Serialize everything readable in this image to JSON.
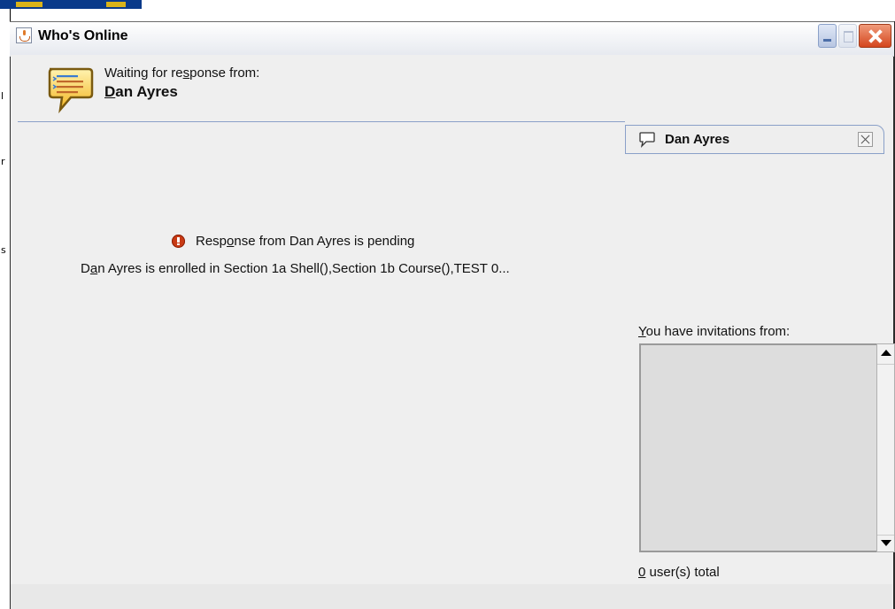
{
  "window": {
    "title": "Who's Online"
  },
  "header": {
    "waiting_prefix": "Waiting for re",
    "waiting_mnemonic": "s",
    "waiting_suffix": "ponse from:",
    "user_mnemonic": "D",
    "user_rest": "an Ayres"
  },
  "main": {
    "status_prefix": "Resp",
    "status_mnemonic": "o",
    "status_suffix": "nse from Dan Ayres is pending",
    "enrolled_prefix": "D",
    "enrolled_mnemonic": "a",
    "enrolled_suffix": "n Ayres is enrolled in Section 1a Shell(),Section 1b Course(),TEST 0..."
  },
  "chat_tab": {
    "name": "Dan Ayres"
  },
  "invitations": {
    "label_mnemonic": "Y",
    "label_rest": "ou have invitations from:",
    "items": [],
    "total_mnemonic": "0",
    "total_rest": " user(s) total"
  },
  "colors": {
    "accent_line": "#8aa0c8",
    "warning": "#c83a14",
    "close_button": "#d4461e"
  },
  "icons": {
    "title": "java-cup-icon",
    "header": "speech-bubble-icon",
    "status": "warning-icon",
    "tab": "chat-bubble-icon",
    "tab_close": "close-icon"
  }
}
